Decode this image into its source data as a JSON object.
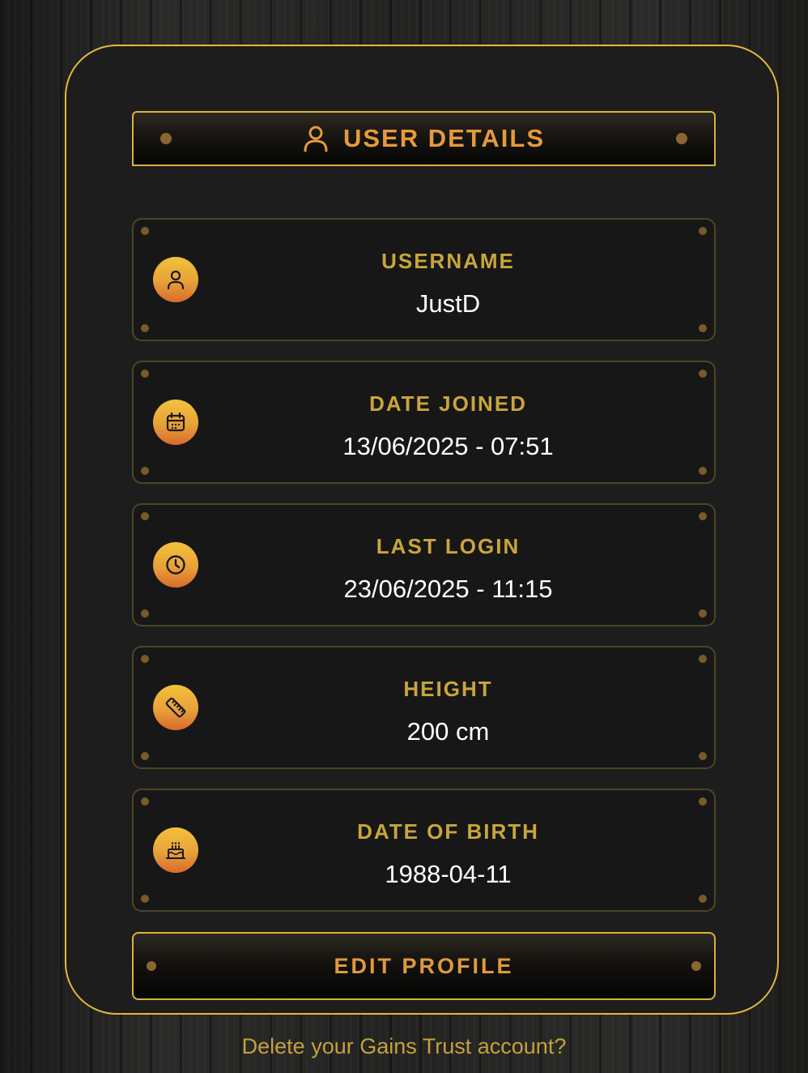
{
  "header": {
    "title": "USER DETAILS",
    "icon": "user-icon"
  },
  "fields": [
    {
      "label": "USERNAME",
      "value": "JustD",
      "icon": "user-icon"
    },
    {
      "label": "DATE JOINED",
      "value": "13/06/2025 - 07:51",
      "icon": "calendar-icon"
    },
    {
      "label": "LAST LOGIN",
      "value": "23/06/2025 - 11:15",
      "icon": "clock-icon"
    },
    {
      "label": "HEIGHT",
      "value": "200 cm",
      "icon": "ruler-icon"
    },
    {
      "label": "DATE OF BIRTH",
      "value": "1988-04-11",
      "icon": "cake-icon"
    }
  ],
  "edit_button": {
    "label": "EDIT PROFILE"
  },
  "delete_link": {
    "label": "Delete your Gains Trust account?"
  },
  "colors": {
    "accent": "#e2b93b",
    "label_gold": "#c9a63b",
    "title_orange": "#e69a3c",
    "icon_gradient_top": "#f2c23a",
    "icon_gradient_bottom": "#d86a2c"
  }
}
